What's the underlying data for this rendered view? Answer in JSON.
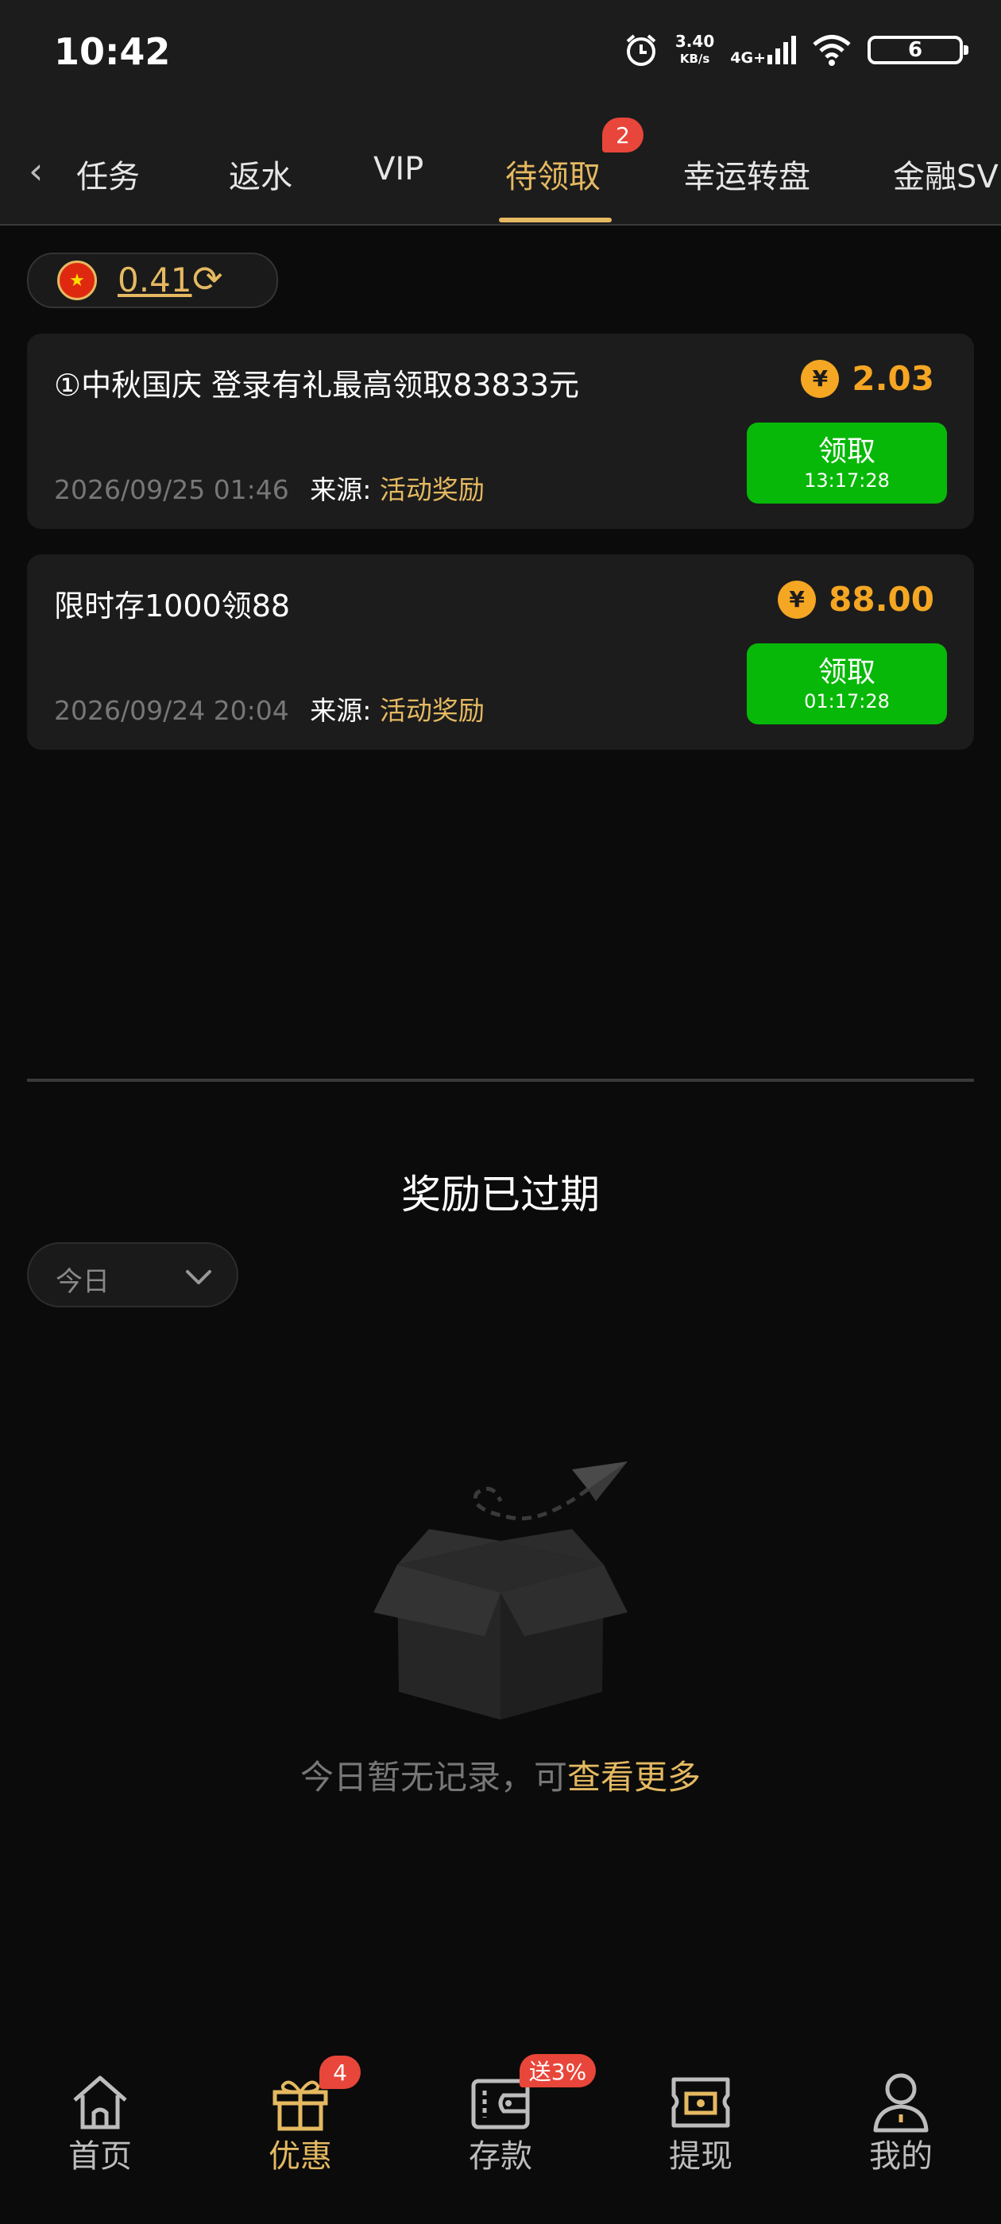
{
  "status": {
    "time": "10:42",
    "speed_value": "3.40",
    "speed_unit": "KB/s",
    "network": "4G+",
    "battery": "6"
  },
  "tabs": {
    "back_icon": "chevron-left-icon",
    "items": [
      {
        "label": "任务"
      },
      {
        "label": "返水"
      },
      {
        "label": "VIP"
      },
      {
        "label": "待领取",
        "active": true,
        "badge": "2"
      },
      {
        "label": "幸运转盘"
      },
      {
        "label": "金融SVIP"
      }
    ]
  },
  "balance": {
    "amount": "0.41",
    "flag": "china-flag-icon",
    "refresh_icon": "refresh-icon"
  },
  "rewards": [
    {
      "title": "①中秋国庆 登录有礼最高领取83833元",
      "amount": "2.03",
      "date": "2026/09/25 01:46",
      "source_label": "来源:",
      "source_value": "活动奖励",
      "button_label": "领取",
      "timer": "13:17:28"
    },
    {
      "title": "限时存1000领88",
      "amount": "88.00",
      "date": "2026/09/24 20:04",
      "source_label": "来源:",
      "source_value": "活动奖励",
      "button_label": "领取",
      "timer": "01:17:28"
    }
  ],
  "expired": {
    "title": "奖励已过期",
    "filter_value": "今日",
    "empty_text": "今日暂无记录，可",
    "empty_link": "查看更多"
  },
  "bottom_nav": [
    {
      "label": "首页",
      "icon": "home-icon"
    },
    {
      "label": "优惠",
      "icon": "gift-icon",
      "active": true,
      "badge": "4"
    },
    {
      "label": "存款",
      "icon": "wallet-icon",
      "badge": "送3%"
    },
    {
      "label": "提现",
      "icon": "withdraw-icon"
    },
    {
      "label": "我的",
      "icon": "user-icon"
    }
  ],
  "colors": {
    "accent": "#e5b961",
    "claim_button": "#08b808",
    "amount": "#f5a623",
    "badge": "#e8463a",
    "background": "#0b0b0b"
  }
}
